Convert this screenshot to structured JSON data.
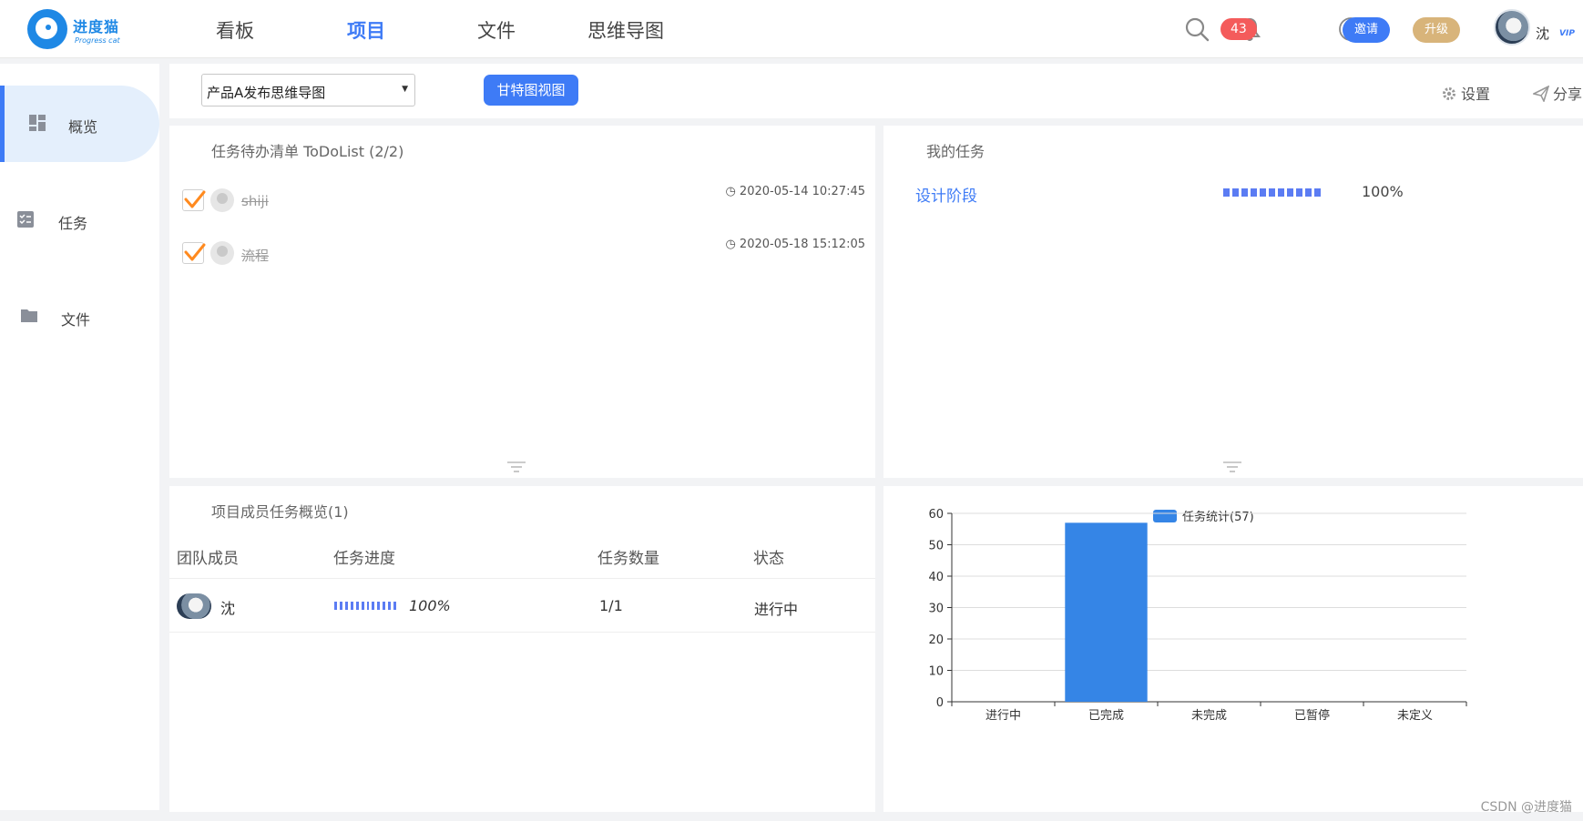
{
  "app": {
    "logo_name": "进度猫",
    "logo_sub": "Progress cat"
  },
  "nav": {
    "items": [
      {
        "label": "看板"
      },
      {
        "label": "项目",
        "active": true
      },
      {
        "label": "文件"
      },
      {
        "label": "思维导图"
      }
    ]
  },
  "header": {
    "notification_count": "43",
    "invite_label": "邀请",
    "upgrade_label": "升级",
    "user_name": "沈",
    "vip_label": "VIP"
  },
  "sidebar": {
    "items": [
      {
        "label": "概览",
        "active": true
      },
      {
        "label": "任务"
      },
      {
        "label": "文件"
      }
    ]
  },
  "toolbar": {
    "project_select_value": "产品A发布思维导图",
    "gantt_label": "甘特图视图",
    "settings_label": "设置",
    "share_label": "分享"
  },
  "todo": {
    "title": "任务待办清单 ToDoList (2/2)",
    "items": [
      {
        "text": "shiji",
        "time": "2020-05-14 10:27:45",
        "done": true
      },
      {
        "text": "流程",
        "time": "2020-05-18 15:12:05",
        "done": true
      }
    ]
  },
  "my_tasks": {
    "title": "我的任务",
    "items": [
      {
        "name": "设计阶段",
        "progress_percent": 100,
        "progress_label": "100%"
      }
    ]
  },
  "members": {
    "title": "项目成员任务概览(1)",
    "columns": [
      "团队成员",
      "任务进度",
      "任务数量",
      "状态"
    ],
    "rows": [
      {
        "name": "沈",
        "progress_percent": 100,
        "progress_label": "100%",
        "count": "1/1",
        "status": "进行中"
      }
    ]
  },
  "chart_data": {
    "type": "bar",
    "categories": [
      "进行中",
      "已完成",
      "未完成",
      "已暂停",
      "未定义"
    ],
    "series": [
      {
        "name": "任务统计(57)",
        "values": [
          0,
          57,
          0,
          0,
          0
        ],
        "color": "#3585e6"
      }
    ],
    "yticks": [
      "0",
      "10",
      "20",
      "30",
      "40",
      "50",
      "60"
    ],
    "ylim": [
      0,
      60
    ],
    "grid": true,
    "legend": "top-center"
  },
  "watermark": "CSDN @进度猫"
}
